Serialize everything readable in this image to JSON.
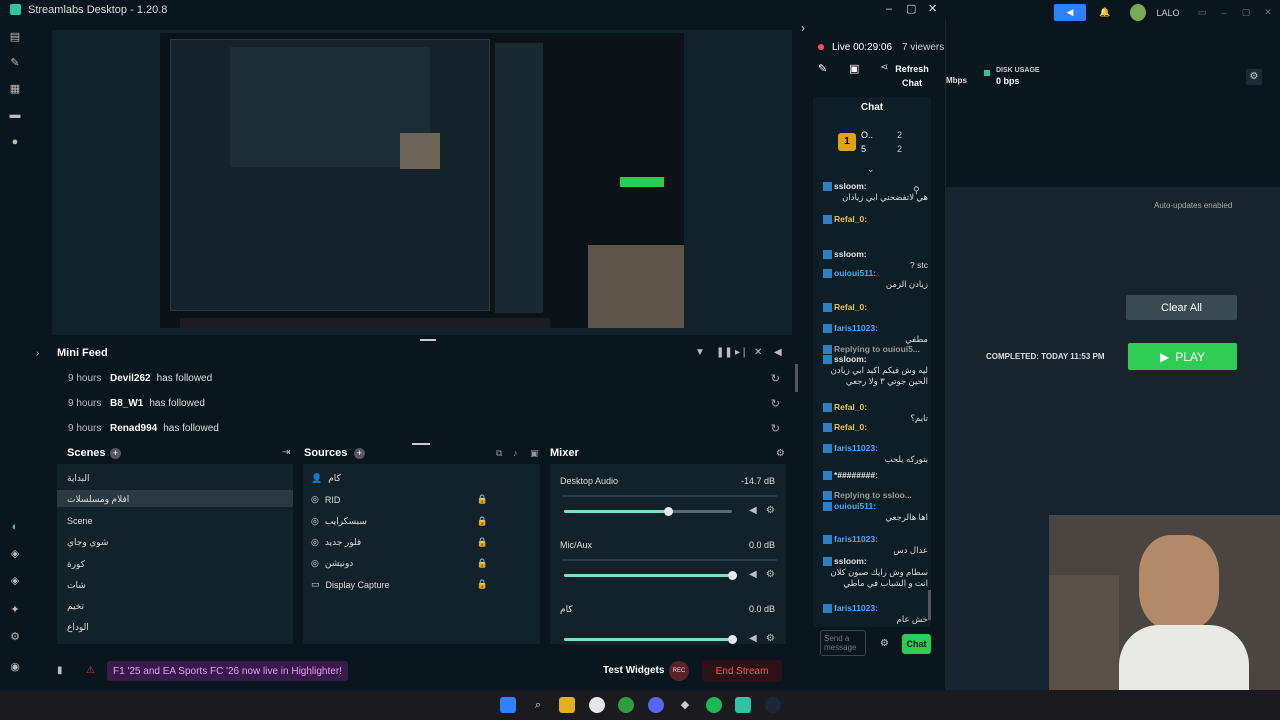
{
  "window": {
    "title": "Streamlabs Desktop - 1.20.8"
  },
  "stream_status": {
    "live_time": "Live 00:29:06",
    "viewers": "7 viewers",
    "refresh_chat": "Refresh Chat"
  },
  "chat": {
    "title": "Chat",
    "leaderboard": {
      "rank": "1",
      "name": "O..",
      "v1": "2",
      "v2": "5",
      "v3": "2"
    },
    "messages": [
      {
        "name": "ssloom:",
        "name_color": "#e6e6e6",
        "text": "هي لاتفضحني ابي زيادان"
      },
      {
        "name": "Refal_0:",
        "name_color": "#e6c44a",
        "text": ""
      },
      {
        "name": "ssloom:",
        "name_color": "#e6e6e6",
        "text": "stc ?"
      },
      {
        "name": "ouioui511:",
        "name_color": "#49a7ff",
        "text": "زيادن الزمن"
      },
      {
        "name": "Refal_0:",
        "name_color": "#e6c44a",
        "text": ""
      },
      {
        "name": "faris11023:",
        "name_color": "#49a7ff",
        "text": "مطفي"
      },
      {
        "name": "Replying to ouioui5...",
        "name_color": "#999999",
        "text": ""
      },
      {
        "name": "ssloom:",
        "name_color": "#e6e6e6",
        "text": "ليه وش فيكم اكيد ابي زيادن الحين جوتي ٣ ولا رجعي"
      },
      {
        "name": "Refal_0:",
        "name_color": "#e6c44a",
        "text": "تايم؟"
      },
      {
        "name": "Refal_0:",
        "name_color": "#e6c44a",
        "text": ""
      },
      {
        "name": "faris11023:",
        "name_color": "#49a7ff",
        "text": "بتوركه يلحب"
      },
      {
        "name": "*########:",
        "name_color": "#e6e6e6",
        "text": ""
      },
      {
        "name": "Replying to ssloo...",
        "name_color": "#999999",
        "text": ""
      },
      {
        "name": "ouioui511:",
        "name_color": "#49a7ff",
        "text": "اها هالرجعي"
      },
      {
        "name": "faris11023:",
        "name_color": "#49a7ff",
        "text": "عدال دس"
      },
      {
        "name": "ssloom:",
        "name_color": "#e6e6e6",
        "text": "سطام وش رايك صبون كلان انت و الشباب في ماطي"
      },
      {
        "name": "faris11023:",
        "name_color": "#49a7ff",
        "text": "خش عام"
      }
    ],
    "input_placeholder": "Send a message",
    "send_label": "Chat"
  },
  "minifeed": {
    "title": "Mini Feed",
    "items": [
      {
        "time": "9 hours",
        "user": "Devil262",
        "action": "has followed"
      },
      {
        "time": "9 hours",
        "user": "B8_W1",
        "action": "has followed"
      },
      {
        "time": "9 hours",
        "user": "Renad994",
        "action": "has followed"
      }
    ]
  },
  "scenes": {
    "title": "Scenes",
    "items": [
      "البداية",
      "افلام ومسلسلات",
      "Scene",
      "شوي وجاي",
      "كورة",
      "شات",
      "تخيم",
      "الوداع"
    ],
    "selected_index": 1
  },
  "sources": {
    "title": "Sources",
    "items": [
      {
        "icon": "person-icon",
        "label": "كام"
      },
      {
        "icon": "globe-icon",
        "label": "RID"
      },
      {
        "icon": "globe-icon",
        "label": "سبسكرايب"
      },
      {
        "icon": "globe-icon",
        "label": "فلور جديد"
      },
      {
        "icon": "globe-icon",
        "label": "دونيشن"
      },
      {
        "icon": "monitor-icon",
        "label": "Display Capture"
      }
    ]
  },
  "mixer": {
    "title": "Mixer",
    "channels": [
      {
        "name": "Desktop Audio",
        "db": "-14.7 dB",
        "level": 0.62
      },
      {
        "name": "Mic/Aux",
        "db": "0.0 dB",
        "level": 1.0
      },
      {
        "name": "كام",
        "db": "0.0 dB",
        "level": 1.0
      }
    ]
  },
  "footer": {
    "notice": "F1 '25 and EA Sports FC '26 now live in Highlighter!",
    "test_widgets": "Test Widgets",
    "rec": "REC",
    "end_stream": "End Stream"
  },
  "background_app": {
    "user": "LALO",
    "disk_label": "DISK USAGE",
    "disk_value": "0 bps",
    "mbps": "Mbps",
    "auto_updates": "Auto-updates enabled",
    "clear_all": "Clear All",
    "completed": "COMPLETED: TODAY 11:53 PM",
    "play": "PLAY"
  },
  "colors": {
    "accent": "#31c3a2",
    "end_stream": "#dc3545",
    "notice_bg": "#3a1a4a",
    "play_green": "#2ecc55"
  }
}
